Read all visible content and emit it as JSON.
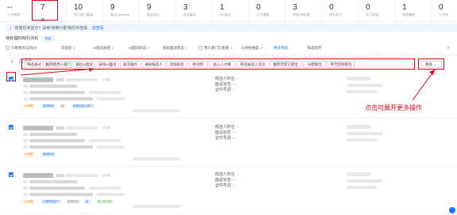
{
  "stats": [
    {
      "num": "--",
      "label": "人才推荐"
    },
    {
      "num": "7",
      "label": "处理",
      "active": true
    },
    {
      "num": "10",
      "label": "用人部门筛选"
    },
    {
      "num": "9",
      "label": "笔试 (Written)"
    },
    {
      "num": "9",
      "label": "面试初试"
    },
    {
      "num": "3",
      "label": "面试复试"
    },
    {
      "num": "1",
      "label": "HR面试"
    },
    {
      "num": "0",
      "label": "人才储备"
    },
    {
      "num": "3",
      "label": "待面/待处理"
    },
    {
      "num": "0",
      "label": "待办学习"
    },
    {
      "num": "0",
      "label": "学习考核"
    },
    {
      "num": "1",
      "label": "待签署库"
    },
    {
      "num": "0",
      "label": "人才库"
    }
  ],
  "notice": {
    "icon": "i",
    "text": "有简历未显示？请到'待筛分配'简历中查看",
    "link": "去查看"
  },
  "pending": {
    "label": "待处理的简历(共8)",
    "pill": "待定"
  },
  "filters": {
    "check1": "只看我参与的(0)",
    "dd1": "年龄段",
    "dd2": "AI面试总结",
    "dd3": "AI面试状态",
    "dd4": "系统面试状态",
    "check2": "用人部门已查看",
    "dd5": "AI评估维度",
    "adv": "更多筛选",
    "sort": "筛选排序"
  },
  "actions": {
    "select_all": "全选",
    "count": "1",
    "buttons": [
      "筛选通过",
      "推荐给用人部门",
      "发起AI面试",
      "安排AI面试",
      "再次邀约",
      "通知候选人",
      "添加标签",
      "移动到",
      "加入人才库",
      "筛选候选人淘汰",
      "推荐到其它职位",
      "分配职位",
      "移至其他职位"
    ],
    "more": "更多"
  },
  "cards": [
    {
      "checked": true,
      "time": "2天前",
      "f1": "候选人所在",
      "f2": "面试状态",
      "f3": "证件号调",
      "v1": "—",
      "v2": "—",
      "v3": "—",
      "tags": [
        "AI初筛",
        "推荐阶段",
        "面",
        "推荐给用人部门"
      ]
    },
    {
      "checked": true,
      "time": "3天前",
      "f1": "候选人所在",
      "f2": "面试状态",
      "f3": "证件号调",
      "v1": "—",
      "v2": "—",
      "v3": "—",
      "tags": [
        "AI初筛",
        "推荐阶段"
      ]
    },
    {
      "checked": true,
      "time": "4天前",
      "f1": "候选人所在",
      "f2": "面试状态",
      "f3": "证件号调",
      "v1": "—",
      "v2": "—",
      "v3": "—",
      "tags": [
        "AI初筛",
        "已推荐给部门",
        "推荐阶段",
        "投",
        "第二轮沟通"
      ]
    }
  ],
  "annotation": "点击可展开更多操作",
  "colors": {
    "accent": "#1677ff",
    "annotation": "#e60012",
    "tag_orange": "#fa8c16",
    "tag_green": "#52c41a"
  }
}
